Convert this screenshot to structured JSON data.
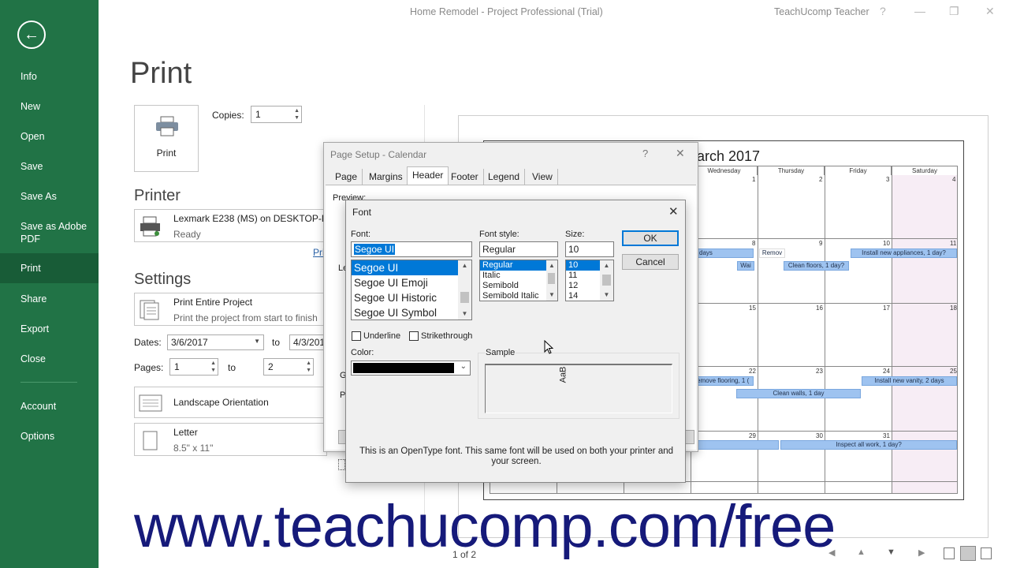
{
  "titlebar": {
    "title": "Home Remodel  -  Project Professional (Trial)",
    "user": "TeachUcomp Teacher",
    "help": "?",
    "minimize": "—",
    "restore": "❐",
    "close": "✕"
  },
  "nav": {
    "back_icon": "←",
    "items": [
      "Info",
      "New",
      "Open",
      "Save",
      "Save As",
      "Save as Adobe PDF",
      "Print",
      "Share",
      "Export",
      "Close",
      "Account",
      "Options"
    ],
    "active": "Print"
  },
  "print": {
    "heading": "Print",
    "print_button": "Print",
    "copies_label": "Copies:",
    "copies_value": "1",
    "printer_heading": "Printer",
    "printer_name": "Lexmark E238 (MS) on DESKTOP-PC",
    "printer_status": "Ready",
    "printer_props_link": "Pri",
    "settings_heading": "Settings",
    "scope_title": "Print Entire Project",
    "scope_desc": "Print the project from start to finish",
    "dates_label": "Dates:",
    "date_from": "3/6/2017",
    "to_label": "to",
    "date_to": "4/3/201",
    "pages_label": "Pages:",
    "page_from": "1",
    "page_to": "2",
    "orientation": "Landscape Orientation",
    "paper_name": "Letter",
    "paper_size": "8.5\" x 11\""
  },
  "calendar": {
    "title": "arch 2017",
    "day_names": [
      "Wednesday",
      "Thursday",
      "Friday",
      "Saturday"
    ],
    "weeks": [
      {
        "days": [
          "1",
          "2",
          "3",
          "4"
        ]
      },
      {
        "days": [
          "8",
          "9",
          "10",
          "11"
        ]
      },
      {
        "days": [
          "15",
          "16",
          "17",
          "18"
        ]
      },
      {
        "days": [
          "22",
          "23",
          "24",
          "25"
        ]
      },
      {
        "days": [
          "29",
          "30",
          "31",
          ""
        ]
      }
    ],
    "bars": [
      "days",
      "Remov",
      "Install new appliances, 1 day?",
      "Wai",
      "Clean floors, 1 day?",
      "emove flooring, 1 (",
      "Install new vanity, 2 days",
      "Clean walls, 1 day",
      "Inspect all work, 1 day?"
    ],
    "page_indicator": "1 of 2"
  },
  "page_setup": {
    "title": "Page Setup - Calendar",
    "help": "?",
    "close": "✕",
    "tabs": [
      "Page",
      "Margins",
      "Header",
      "Footer",
      "Legend",
      "View"
    ],
    "active_tab": "Header",
    "preview_label": "Preview:",
    "partial_labels": [
      "Le",
      "G",
      "P"
    ]
  },
  "font_dialog": {
    "title": "Font",
    "close": "✕",
    "font_label": "Font:",
    "font_value": "Segoe UI",
    "font_list": [
      "Segoe UI",
      "Segoe UI Emoji",
      "Segoe UI Historic",
      "Segoe UI Symbol"
    ],
    "style_label": "Font style:",
    "style_value": "Regular",
    "style_list": [
      "Regular",
      "Italic",
      "Semibold",
      "Semibold Italic"
    ],
    "size_label": "Size:",
    "size_value": "10",
    "size_list": [
      "10",
      "11",
      "12",
      "14"
    ],
    "ok": "OK",
    "cancel": "Cancel",
    "underline": "Underline",
    "strikethrough": "Strikethrough",
    "color_label": "Color:",
    "color_value": "#000000",
    "sample_label": "Sample",
    "sample_text": "AaB",
    "info": "This is an OpenType font. This same font will be used on both your printer and your screen."
  },
  "watermark": "www.teachucomp.com/free"
}
